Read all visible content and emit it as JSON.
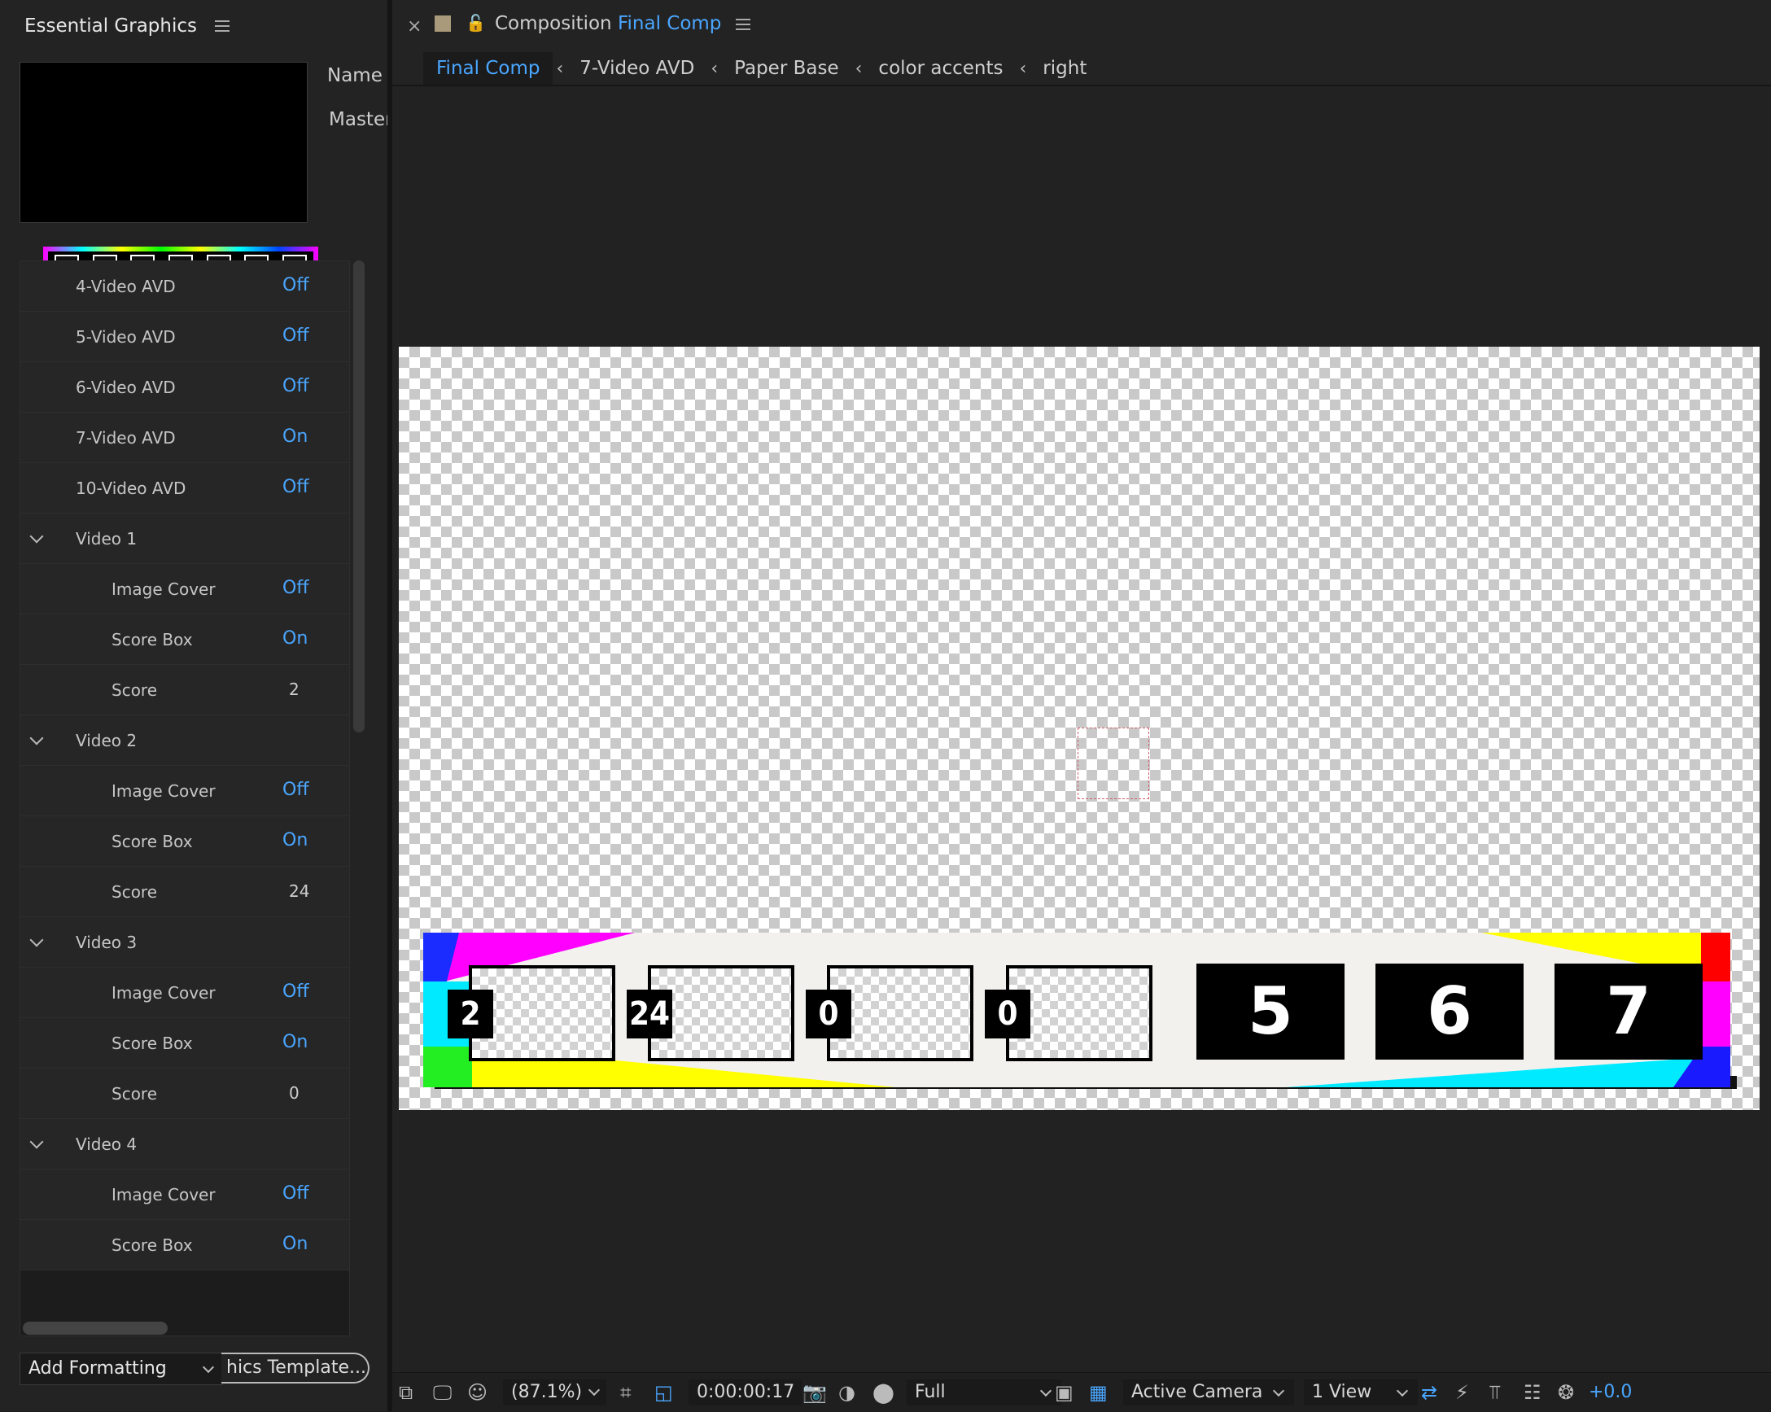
{
  "left_panel": {
    "title": "Essential Graphics",
    "name_label": "Name",
    "master_label": "Master",
    "properties": [
      {
        "label": "4-Video AVD",
        "value": "Off",
        "kind": "toggle",
        "indent": 0
      },
      {
        "label": "5-Video AVD",
        "value": "Off",
        "kind": "toggle",
        "indent": 0
      },
      {
        "label": "6-Video AVD",
        "value": "Off",
        "kind": "toggle",
        "indent": 0
      },
      {
        "label": "7-Video AVD",
        "value": "On",
        "kind": "toggle",
        "indent": 0
      },
      {
        "label": "10-Video AVD",
        "value": "Off",
        "kind": "toggle",
        "indent": 0
      },
      {
        "label": "Video 1",
        "kind": "group"
      },
      {
        "label": "Image Cover",
        "value": "Off",
        "kind": "toggle",
        "indent": 1
      },
      {
        "label": "Score Box",
        "value": "On",
        "kind": "toggle",
        "indent": 1
      },
      {
        "label": "Score",
        "value": "2",
        "kind": "number",
        "indent": 1
      },
      {
        "label": "Video 2",
        "kind": "group"
      },
      {
        "label": "Image Cover",
        "value": "Off",
        "kind": "toggle",
        "indent": 1
      },
      {
        "label": "Score Box",
        "value": "On",
        "kind": "toggle",
        "indent": 1
      },
      {
        "label": "Score",
        "value": "24",
        "kind": "number",
        "indent": 1
      },
      {
        "label": "Video 3",
        "kind": "group"
      },
      {
        "label": "Image Cover",
        "value": "Off",
        "kind": "toggle",
        "indent": 1
      },
      {
        "label": "Score Box",
        "value": "On",
        "kind": "toggle",
        "indent": 1
      },
      {
        "label": "Score",
        "value": "0",
        "kind": "number",
        "indent": 1
      },
      {
        "label": "Video 4",
        "kind": "group"
      },
      {
        "label": "Image Cover",
        "value": "Off",
        "kind": "toggle",
        "indent": 1
      },
      {
        "label": "Score Box",
        "value": "On",
        "kind": "toggle",
        "indent": 1
      }
    ],
    "add_formatting": "Add Formatting",
    "export_button": "hics Template..."
  },
  "composition": {
    "title_prefix": "Composition",
    "title_name": "Final Comp",
    "breadcrumbs": [
      "Final Comp",
      "7-Video AVD",
      "Paper Base",
      "color accents",
      "right"
    ],
    "slot_scores": [
      "2",
      "24",
      "0",
      "0"
    ],
    "box_numbers": [
      "5",
      "6",
      "7"
    ]
  },
  "toolbar": {
    "zoom": "(87.1%)",
    "timecode": "0:00:00:17",
    "resolution": "Full",
    "camera": "Active Camera",
    "views": "1 View",
    "exposure": "+0.0"
  },
  "colors": {
    "accent_blue": "#4aa6ff",
    "panel_bg": "#232323"
  }
}
